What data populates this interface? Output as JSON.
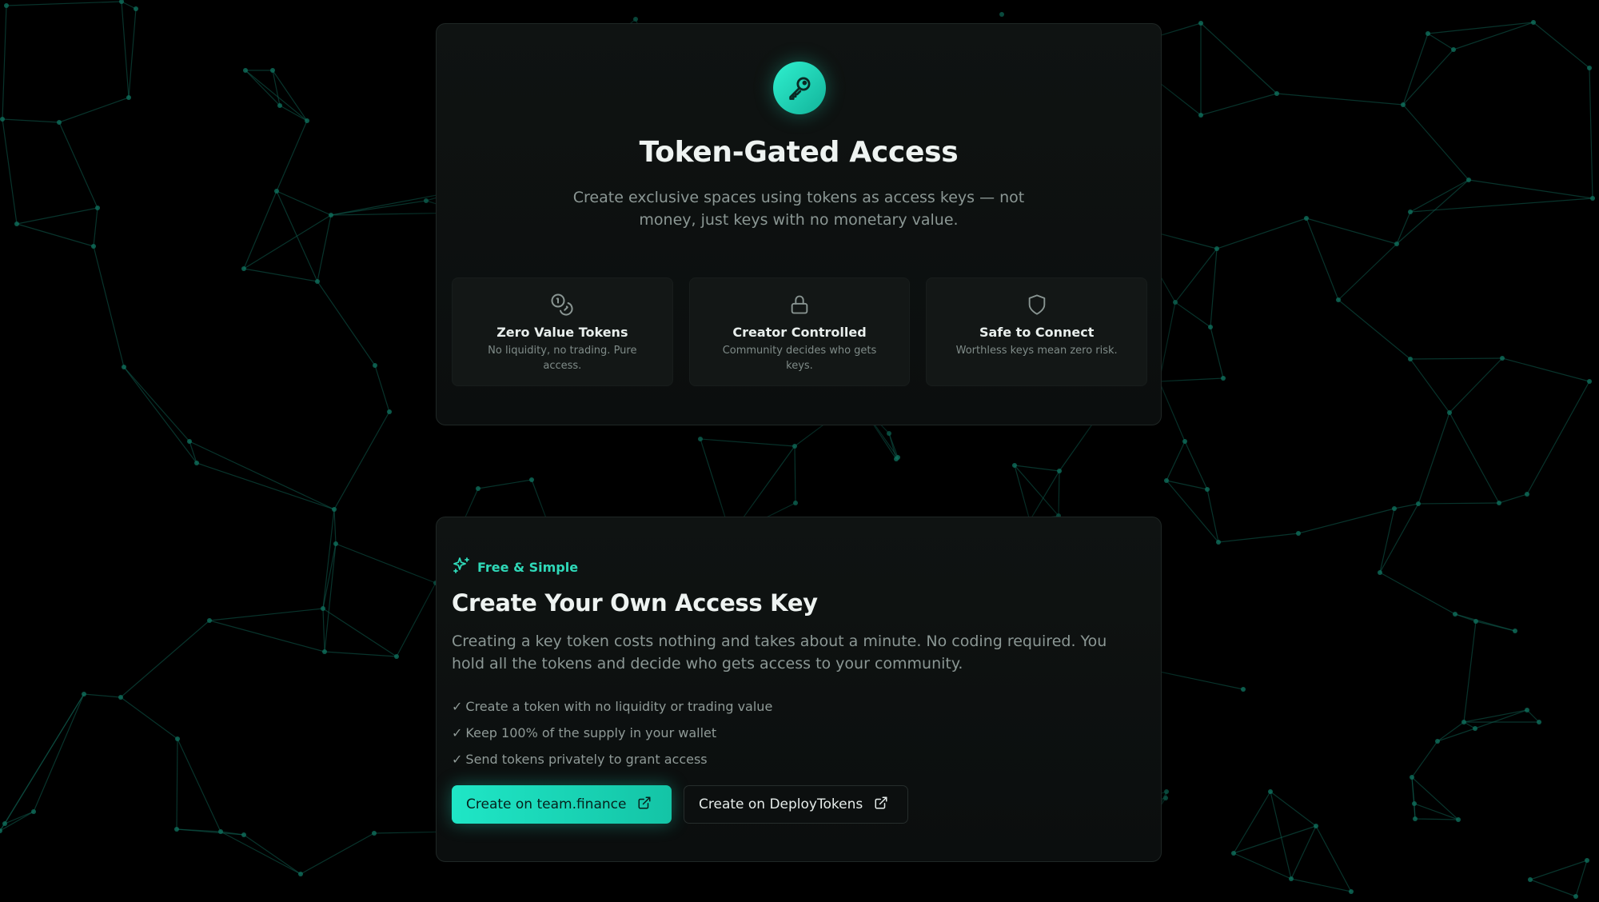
{
  "hero": {
    "icon": "key-icon",
    "title": "Token-Gated Access",
    "subtitle": "Create exclusive spaces using tokens as access keys — not money, just keys with no monetary value."
  },
  "features": [
    {
      "icon": "coins-icon",
      "title": "Zero Value Tokens",
      "description": "No liquidity, no trading. Pure access."
    },
    {
      "icon": "lock-icon",
      "title": "Creator Controlled",
      "description": "Community decides who gets keys."
    },
    {
      "icon": "shield-icon",
      "title": "Safe to Connect",
      "description": "Worthless keys mean zero risk."
    }
  ],
  "create": {
    "tag_icon": "sparkles-icon",
    "tag": "Free & Simple",
    "title": "Create Your Own Access Key",
    "description": "Creating a key token costs nothing and takes about a minute. No coding required. You hold all the tokens and decide who gets access to your community.",
    "check_mark": "✓",
    "checklist": [
      "Create a token with no liquidity or trading value",
      "Keep 100% of the supply in your wallet",
      "Send tokens privately to grant access"
    ],
    "buttons": {
      "primary_label": "Create on team.finance",
      "secondary_label": "Create on DeployTokens",
      "icon": "external-link-icon"
    }
  },
  "colors": {
    "accent": "#1fe6c6",
    "accent_text": "#2fd9b9",
    "background": "#000000",
    "card": "#0f1312",
    "muted_text": "#8b9794"
  }
}
